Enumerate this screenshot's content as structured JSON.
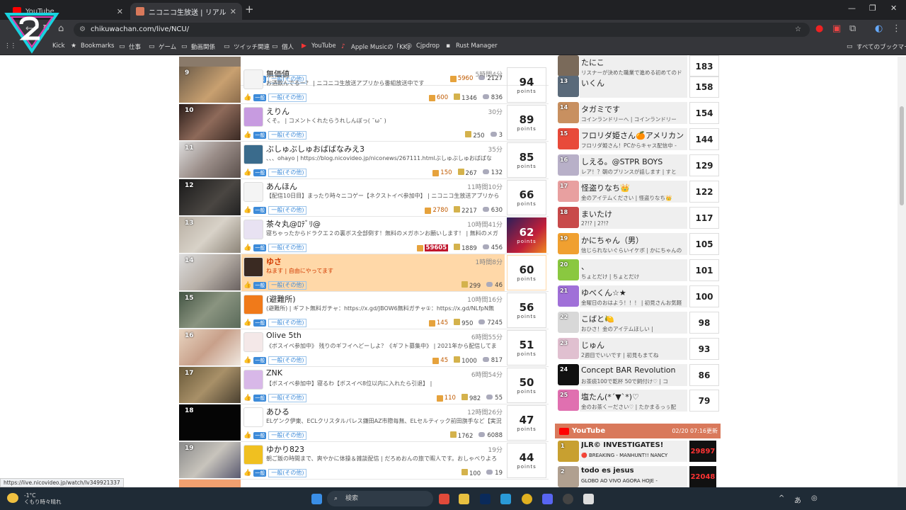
{
  "browser": {
    "tabs": [
      {
        "title": "YouTube"
      },
      {
        "title": "ニコニコ生放送 | リアルタイムランキ"
      }
    ],
    "url": "chikuwachan.com/live/NCU/",
    "bookmarks": [
      "Kick",
      "Bookmarks",
      "仕事",
      "ゲーム",
      "動画関係",
      "ツイッチ関連",
      "個人",
      "YouTube",
      "Apple Musicの「KK」",
      "Cjpdrop",
      "Rust Manager"
    ],
    "all_bookmarks": "すべてのブックマーク",
    "status_url": "https://live.nicovideo.jp/watch/lv349921337"
  },
  "labels": {
    "points": "points",
    "category": "一般(その他)",
    "badge": "一般"
  },
  "ranking": [
    {
      "rank": "",
      "name": "",
      "time": "",
      "desc": "",
      "gift": "5960",
      "views": "",
      "comments": "2127",
      "points": ""
    },
    {
      "rank": "9",
      "name": "無価値",
      "time": "5時間4分",
      "desc": "お酒飲んでるー？ | ニコニコ生放送アプリから番組放送中です",
      "gift": "600",
      "views": "1346",
      "comments": "836",
      "points": "94"
    },
    {
      "rank": "10",
      "name": "えりん",
      "time": "30分",
      "desc": "くそ。 | コメントくれたらうれしんぼっ( ˘ω˘ )",
      "gift": "",
      "views": "250",
      "comments": "3",
      "points": "89"
    },
    {
      "rank": "11",
      "name": "ぶしゅぶしゅおばばなみえ3",
      "time": "35分",
      "desc": "、、、ohayo | https://blog.nicovideo.jp/niconews/267111.htmlぶしゅぶしゅおばばな",
      "gift": "150",
      "views": "267",
      "comments": "132",
      "points": "85"
    },
    {
      "rank": "12",
      "name": "あんほん",
      "time": "11時間10分",
      "desc": "【配信10日目】まったり時々ニコゲー【ネクストイベ参加中】 | ニコニコ生放送アプリから",
      "gift": "2780",
      "views": "2217",
      "comments": "630",
      "points": "66"
    },
    {
      "rank": "13",
      "name": "茶々丸@ﾛﾃﾞﾘ@",
      "time": "10時間41分",
      "desc": "寝ちゃったからドラクエ２の裏ボス全部倒す！無料のメガホンお願いします！ | 無料のメガ",
      "gift": "59605",
      "views": "1889",
      "comments": "456",
      "points": "62"
    },
    {
      "rank": "14",
      "name": "ゆさ",
      "time": "1時間8分",
      "desc": "ねます | 自由にやってます",
      "gift": "",
      "views": "299",
      "comments": "46",
      "points": "60"
    },
    {
      "rank": "15",
      "name": "(避難所)",
      "time": "10時間16分",
      "desc": "(避難所) | ギフト無料ガチャ：https://x.gd/JBOW6無料ガチャ①：https://x.gd/NLfpN無",
      "gift": "145",
      "views": "950",
      "comments": "7245",
      "points": "56"
    },
    {
      "rank": "16",
      "name": "Olive 5th",
      "time": "6時間55分",
      "desc": "《ボスイベ参加中》 残りのギフイへどーしよ？《ギフト募集中》 | 2021年から配信してま",
      "gift": "45",
      "views": "1000",
      "comments": "817",
      "points": "51"
    },
    {
      "rank": "17",
      "name": "ZNK",
      "time": "6時間54分",
      "desc": "【ボスイベ参加中】寝るわ【ボスイベ8位以内に入れたら引退】 |",
      "gift": "110",
      "views": "982",
      "comments": "55",
      "points": "50"
    },
    {
      "rank": "18",
      "name": "あひる",
      "time": "12時間26分",
      "desc": "ELゲンク伊東、ECLクリスタルパレス鎌田AZ市際毎無、ELセルティック前田旗手など【実況",
      "gift": "",
      "views": "1762",
      "comments": "6088",
      "points": "47"
    },
    {
      "rank": "19",
      "name": "ゆかり823",
      "time": "19分",
      "desc": "朝ご飯の時間まで、爽やかに体操＆雑談配信 | だろめおんの旅で暇人です。おしゃべりよろ",
      "gift": "",
      "views": "100",
      "comments": "19",
      "points": "44"
    }
  ],
  "side_ranking": [
    {
      "rank": "",
      "name": "たにこ",
      "desc": "リスナーが決めた職業で進める初めてのド",
      "score": "183"
    },
    {
      "rank": "13",
      "name": "いくん",
      "desc": "",
      "score": "158"
    },
    {
      "rank": "14",
      "name": "タガミです",
      "desc": "コインランドリーへ | コインランドリー",
      "score": "154"
    },
    {
      "rank": "15",
      "name": "フロリダ姫さん🍊アメリカン",
      "desc": "フロリダ姫さん！PCからキャス配信中 -",
      "score": "144"
    },
    {
      "rank": "16",
      "name": "しえる。@STPR BOYS",
      "desc": "レア！？朝のプリンスが話します | すと",
      "score": "129"
    },
    {
      "rank": "17",
      "name": "怪盗りなち👑",
      "desc": "金のアイテムください | 怪盗りなち👑",
      "score": "122"
    },
    {
      "rank": "18",
      "name": "まいたけ",
      "desc": "2?!? | 2?!?",
      "score": "117"
    },
    {
      "rank": "19",
      "name": "かにちゃん（男）",
      "desc": "信じられないぐらいイケボ | かにちゃんの",
      "score": "105"
    },
    {
      "rank": "20",
      "name": "、",
      "desc": "ちょとだけ | ちょとだけ",
      "score": "101"
    },
    {
      "rank": "21",
      "name": "ゆべくん☆★",
      "desc": "金曜日のおはよう！！！ | 初見さんお気軽",
      "score": "100"
    },
    {
      "rank": "22",
      "name": "こばと🍋",
      "desc": "おひさ！金のアイテムほしい | ",
      "score": "98"
    },
    {
      "rank": "23",
      "name": "じゅん",
      "desc": "2週目でいいです | 初見もまてね",
      "score": "93"
    },
    {
      "rank": "24",
      "name": "Concept BAR Revolution",
      "desc": "お茶痰100で乾杯 50で飼付け♡ | コ",
      "score": "86"
    },
    {
      "rank": "25",
      "name": "塩たん(*´▼`*)♡",
      "desc": "金のお茶くーださい♡ | たかまるっぅ配",
      "score": "79"
    }
  ],
  "youtube": {
    "title": "YouTube",
    "updated": "02/20 07:16更新",
    "items": [
      {
        "rank": "1",
        "name": "JLR© INVESTIGATES!",
        "desc": "🔴 BREAKING - MANHUNT!! NANCY",
        "score": "29897"
      },
      {
        "rank": "2",
        "name": "todo es jesus",
        "desc": "GLOBO AO VIVO AGORA HOJE -",
        "score": "22048"
      }
    ]
  },
  "taskbar": {
    "temp": "-1°C",
    "weather": "くもり時々晴れ",
    "search": "検索"
  }
}
